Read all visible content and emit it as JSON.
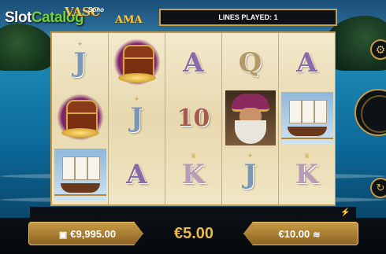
{
  "brand": {
    "part1": "Slot",
    "part2": "Catalog"
  },
  "game_logo": {
    "line1": "VASC",
    "line2": "Sono",
    "line3": "AMA"
  },
  "lines_played": "LINES PLAYED: 1",
  "reels": [
    [
      {
        "symbol": "J"
      },
      {
        "symbol": "chest"
      },
      {
        "symbol": "ship"
      }
    ],
    [
      {
        "symbol": "chest"
      },
      {
        "symbol": "J"
      },
      {
        "symbol": "A"
      }
    ],
    [
      {
        "symbol": "A"
      },
      {
        "symbol": "10"
      },
      {
        "symbol": "K"
      }
    ],
    [
      {
        "symbol": "Q"
      },
      {
        "symbol": "captain"
      },
      {
        "symbol": "J"
      }
    ],
    [
      {
        "symbol": "A"
      },
      {
        "symbol": "ship"
      },
      {
        "symbol": "K"
      }
    ]
  ],
  "balance": "€9,995.00",
  "bet": "€5.00",
  "win": "€10.00",
  "icons": {
    "balance": "wallet-icon",
    "win": "coin-stack-icon",
    "spin": "spin-icon",
    "settings": "gear-icon",
    "autoplay": "autoplay-icon",
    "turbo": "lightning-icon"
  }
}
